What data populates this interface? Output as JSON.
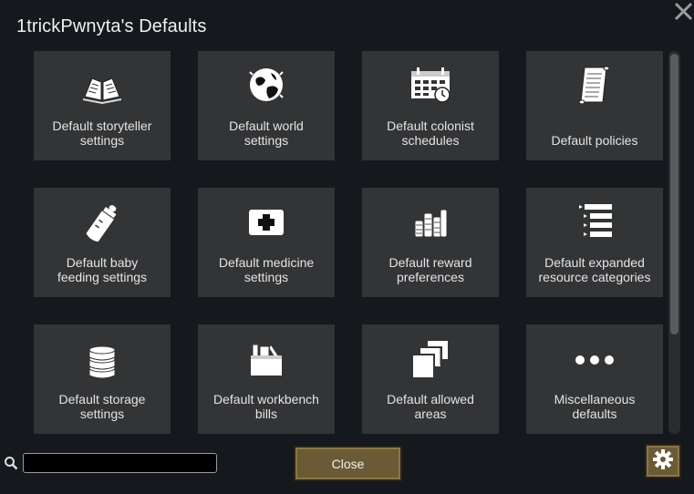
{
  "window": {
    "title": "1trickPwnyta's Defaults"
  },
  "tiles": [
    {
      "label": "Default storyteller\nsettings",
      "icon": "open-book-icon"
    },
    {
      "label": "Default world\nsettings",
      "icon": "globe-icon"
    },
    {
      "label": "Default colonist\nschedules",
      "icon": "calendar-clock-icon"
    },
    {
      "label": "Default policies",
      "icon": "scroll-icon"
    },
    {
      "label": "Default baby\nfeeding settings",
      "icon": "baby-bottle-icon"
    },
    {
      "label": "Default medicine\nsettings",
      "icon": "medkit-icon"
    },
    {
      "label": "Default reward\npreferences",
      "icon": "silver-stacks-icon"
    },
    {
      "label": "Default expanded\nresource categories",
      "icon": "tree-list-icon"
    },
    {
      "label": "Default storage\nsettings",
      "icon": "database-icon"
    },
    {
      "label": "Default workbench\nbills",
      "icon": "toolbox-icon"
    },
    {
      "label": "Default allowed\nareas",
      "icon": "stacked-areas-icon"
    },
    {
      "label": "Miscellaneous\ndefaults",
      "icon": "ellipsis-icon"
    }
  ],
  "footer": {
    "search_placeholder": "",
    "search_value": "",
    "close_label": "Close"
  },
  "colors": {
    "background": "#15181c",
    "tile": "#333436",
    "button": "#6b5a36"
  }
}
